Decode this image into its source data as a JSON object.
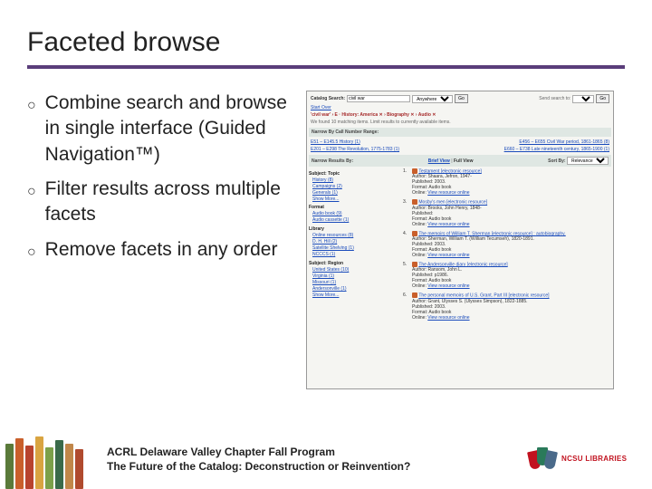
{
  "title": "Faceted browse",
  "bullets": [
    "Combine search and browse in single interface (Guided Navigation™)",
    "Filter results across multiple facets",
    "Remove facets in any order"
  ],
  "shot": {
    "searchLabel": "Catalog Search:",
    "searchValue": "civil war",
    "scope": "Anywhere",
    "go": "Go",
    "sendLabel": "Send search to:",
    "startOver": "Start Over",
    "crumbs": "'civil war' › E · History: America ✕ › Biography ✕ › Audio ✕",
    "found": "We found 10 matching items. Limit results to currently available items.",
    "narrowCall": "Narrow By Call Number Range:",
    "call1": "E51 – E145.5 History (1)",
    "call1r": "E456 – E655 Civil War period, 1861-1865 (8)",
    "call2": "E201 – E298 The Revolution, 1775-1783 (1)",
    "call2r": "E660 – E738 Late nineteenth century, 1865-1900 (1)",
    "narrowBy": "Narrow Results By:",
    "briefFull": {
      "brief": "Brief View",
      "full": "Full View"
    },
    "sortLabel": "Sort By:",
    "sortValue": "Relevance",
    "facets": {
      "topicH": "Subject: Topic",
      "topic": [
        "History (8)",
        "Campaigns (2)",
        "Generals (1)"
      ],
      "topicMore": "Show More...",
      "formatH": "Format",
      "format": [
        "Audio book (9)",
        "Audio cassette (1)"
      ],
      "libraryH": "Library",
      "library": [
        "Online resources (8)",
        "D. H. Hill (2)",
        "Satellite Shelving (1)",
        "NCCCS (1)"
      ],
      "regionH": "Subject: Region",
      "region": [
        "United States (10)",
        "Virginia (1)",
        "Missouri (1)",
        "Andersonville (1)"
      ],
      "regionMore": "Show More..."
    },
    "results": [
      {
        "n": "1.",
        "title": "Testament [electronic resource]",
        "author": "Author: Shaara, Jefron, 1947-",
        "pub": "Published: 2003.",
        "fmt": "Format: Audio book",
        "online": "Online: View resource online"
      },
      {
        "n": "3.",
        "title": "Mosby's men [electronic resource]",
        "author": "Author: Brooks, John Henry, 1848-",
        "pub": "Published:",
        "fmt": "Format: Audio book",
        "online": "Online: View resource online"
      },
      {
        "n": "4.",
        "title": "The memoirs of William T. Sherman [electronic resource] : autobiography.",
        "author": "Author: Sherman, William T. (William Tecumseh), 1820-1891.",
        "pub": "Published: 2003.",
        "fmt": "Format: Audio book",
        "online": "Online: View resource online"
      },
      {
        "n": "5.",
        "title": "The Andersonville diary [electronic resource]",
        "author": "Author: Ransom, John L.",
        "pub": "Published: p1986.",
        "fmt": "Format: Audio book",
        "online": "Online: View resource online"
      },
      {
        "n": "6.",
        "title": "The personal memoirs of U.S. Grant. Part III [electronic resource]",
        "author": "Author: Grant, Ulysses S. (Ulysses Simpson), 1822-1885.",
        "pub": "Published: 2003.",
        "fmt": "Format: Audio book",
        "online": "Online: View resource online"
      }
    ]
  },
  "footer": {
    "line1": "ACRL Delaware Valley Chapter Fall Program",
    "line2": "The Future of the Catalog: Deconstruction or Reinvention?",
    "logoText": "NCSU LIBRARIES"
  }
}
